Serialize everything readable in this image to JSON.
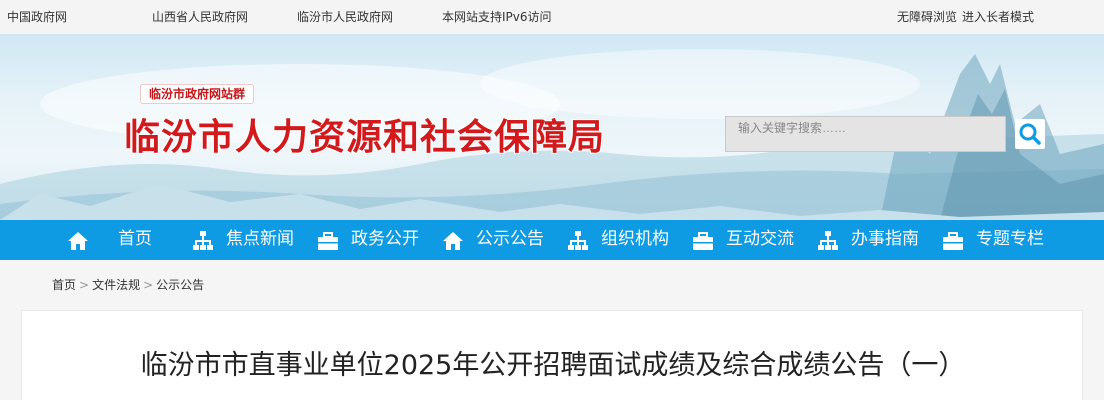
{
  "topbar": {
    "links": [
      "中国政府网",
      "山西省人民政府网",
      "临汾市人民政府网",
      "本网站支持IPv6访问"
    ],
    "accessibility": "无障碍浏览",
    "elder_mode": "进入长者模式"
  },
  "header": {
    "site_group": "临汾市政府网站群",
    "title": "临汾市人力资源和社会保障局",
    "search_placeholder": "输入关键字搜索……"
  },
  "nav": {
    "items": [
      {
        "label": "首页",
        "icon": "home-icon"
      },
      {
        "label": "焦点新闻",
        "icon": "org-chart-icon"
      },
      {
        "label": "政务公开",
        "icon": "briefcase-icon"
      },
      {
        "label": "公示公告",
        "icon": "home-icon"
      },
      {
        "label": "组织机构",
        "icon": "org-chart-icon"
      },
      {
        "label": "互动交流",
        "icon": "briefcase-icon"
      },
      {
        "label": "办事指南",
        "icon": "org-chart-icon"
      },
      {
        "label": "专题专栏",
        "icon": "briefcase-icon"
      }
    ]
  },
  "breadcrumb": [
    "首页",
    "文件法规",
    "公示公告"
  ],
  "article": {
    "title": "临汾市市直事业单位2025年公开招聘面试成绩及综合成绩公告（一）"
  },
  "colors": {
    "nav_bg": "#0f9be3",
    "title_red": "#d2191c"
  }
}
